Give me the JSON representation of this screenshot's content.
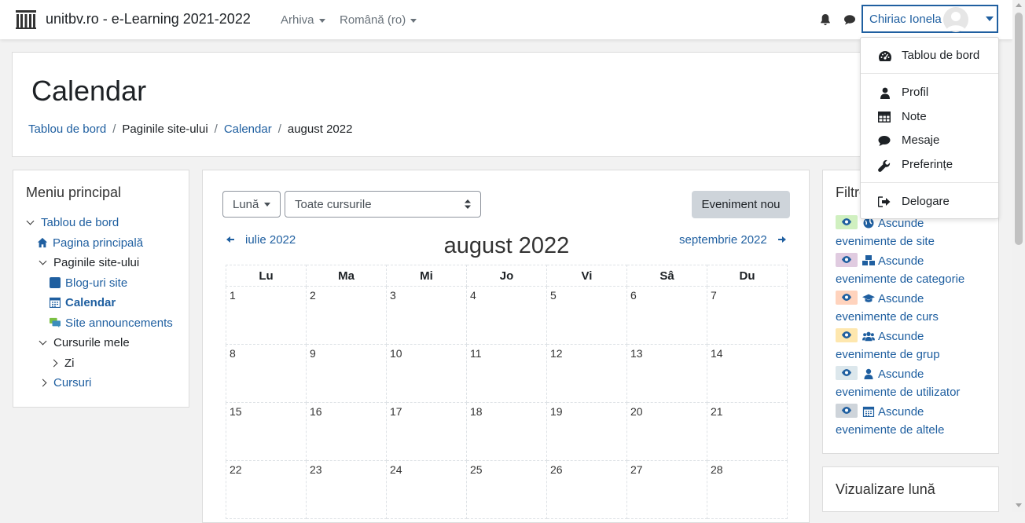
{
  "navbar": {
    "brand": "unitbv.ro - e-Learning 2021-2022",
    "menus": [
      {
        "label": "Arhiva"
      },
      {
        "label": "Română (ro)"
      }
    ],
    "user_name": "Chiriac Ionela"
  },
  "user_menu": {
    "items": [
      {
        "label": "Tablou de bord",
        "icon": "dashboard-icon"
      },
      {
        "label": "Profil",
        "icon": "user-icon"
      },
      {
        "label": "Note",
        "icon": "table-icon"
      },
      {
        "label": "Mesaje",
        "icon": "comment-icon"
      },
      {
        "label": "Preferințe",
        "icon": "wrench-icon"
      },
      {
        "label": "Delogare",
        "icon": "sign-out-icon"
      }
    ]
  },
  "header": {
    "title": "Calendar",
    "breadcrumb": [
      "Tablou de bord",
      "Paginile site-ului",
      "Calendar",
      "august 2022"
    ]
  },
  "nav_block": {
    "title": "Meniu principal",
    "items": [
      {
        "label": "Tablou de bord"
      },
      {
        "label": "Pagina principală"
      },
      {
        "label": "Paginile site-ului"
      },
      {
        "label": "Blog-uri site"
      },
      {
        "label": "Calendar"
      },
      {
        "label": "Site announcements"
      },
      {
        "label": "Cursurile mele"
      },
      {
        "label": "Zi"
      },
      {
        "label": "Cursuri"
      }
    ]
  },
  "calendar": {
    "view_select": "Lună",
    "course_select": "Toate cursurile",
    "new_event": "Eveniment nou",
    "prev_month": "iulie 2022",
    "next_month": "septembrie 2022",
    "month_title": "august 2022",
    "weekdays": [
      "Lu",
      "Ma",
      "Mi",
      "Jo",
      "Vi",
      "Sâ",
      "Du"
    ],
    "weeks": [
      [
        "1",
        "2",
        "3",
        "4",
        "5",
        "6",
        "7"
      ],
      [
        "8",
        "9",
        "10",
        "11",
        "12",
        "13",
        "14"
      ],
      [
        "15",
        "16",
        "17",
        "18",
        "19",
        "20",
        "21"
      ],
      [
        "22",
        "23",
        "24",
        "25",
        "26",
        "27",
        "28"
      ]
    ]
  },
  "filter_block": {
    "title": "Filtre",
    "filters": [
      {
        "hide": "Ascunde",
        "label": "evenimente de site",
        "color": "#d0f0c0"
      },
      {
        "hide": "Ascunde",
        "label": "evenimente de categorie",
        "color": "#e0cbe0"
      },
      {
        "hide": "Ascunde",
        "label": "evenimente de curs",
        "color": "#ffd3bd"
      },
      {
        "hide": "Ascunde",
        "label": "evenimente de grup",
        "color": "#fee7ae"
      },
      {
        "hide": "Ascunde",
        "label": "evenimente de utilizator",
        "color": "#dce7ec"
      },
      {
        "hide": "Ascunde",
        "label": "evenimente de altele",
        "color": "#ced4da"
      }
    ]
  },
  "month_block": {
    "title": "Vizualizare lună"
  }
}
